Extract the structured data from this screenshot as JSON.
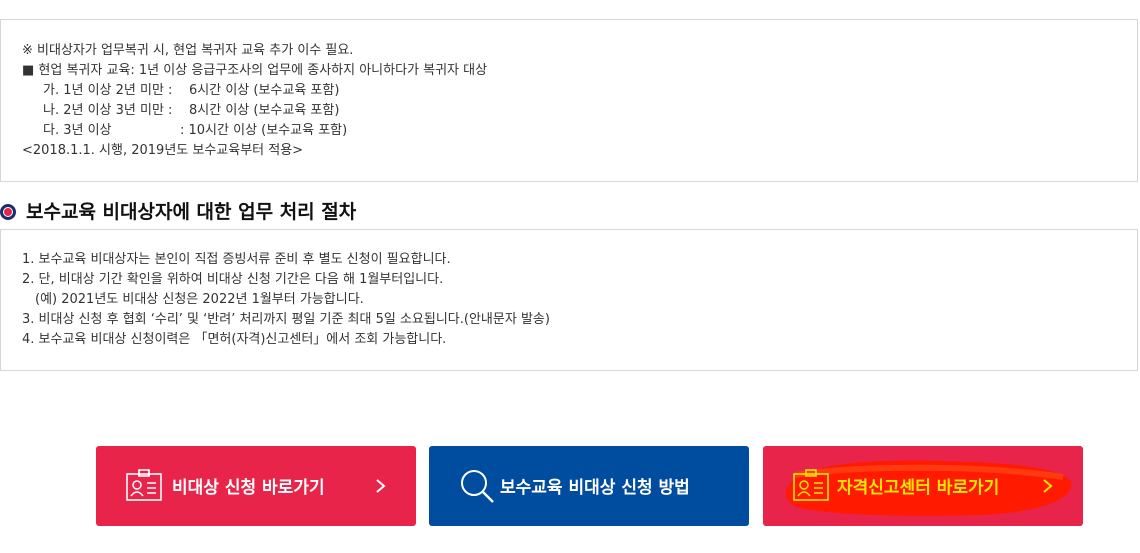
{
  "notice_box": {
    "lines": [
      "※ 비대상자가 업무복귀 시, 현업 복귀자 교육 추가 이수 필요.",
      "■ 현업 복귀자 교육: 1년 이상 응급구조사의 업무에 종사하지 아니하다가 복귀자 대상",
      "가. 1년 이상 2년 미만 :",
      "6시간 이상 (보수교육 포함)",
      "나. 2년 이상 3년 미만 :",
      "8시간 이상 (보수교육 포함)",
      "다. 3년 이상",
      ": 10시간 이상 (보수교육 포함)",
      "<2018.1.1. 시행, 2019년도 보수교육부터 적용>"
    ]
  },
  "section": {
    "title": "보수교육 비대상자에 대한 업무 처리 절차"
  },
  "procedure_box": {
    "lines": [
      "1. 보수교육 비대상자는 본인이 직접 증빙서류 준비 후 별도 신청이 필요합니다.",
      "2. 단, 비대상 기간 확인을 위하여 비대상 신청 기간은 다음 해 1월부터입니다.",
      "(예) 2021년도 비대상 신청은 2022년 1월부터 가능합니다.",
      "3. 비대상 신청 후 협회 ‘수리’ 및 ‘반려’ 처리까지 평일 기준 최대 5일 소요됩니다.(안내문자 발송)",
      "4. 보수교육 비대상 신청이력은 「면허(자격)신고센터」에서 조회 가능합니다."
    ]
  },
  "buttons": [
    {
      "label": "비대상 신청 바로가기",
      "icon": "id-card-icon",
      "color": "#e8244a"
    },
    {
      "label": "보수교육 비대상 신청 방법",
      "icon": "search-icon",
      "color": "#004c9f"
    },
    {
      "label": "자격신고센터 바로가기",
      "icon": "id-card-icon",
      "color": "#e8244a"
    }
  ],
  "annotation": {
    "color": "#ff1a00",
    "highlight_text_color": "#ffe600"
  }
}
